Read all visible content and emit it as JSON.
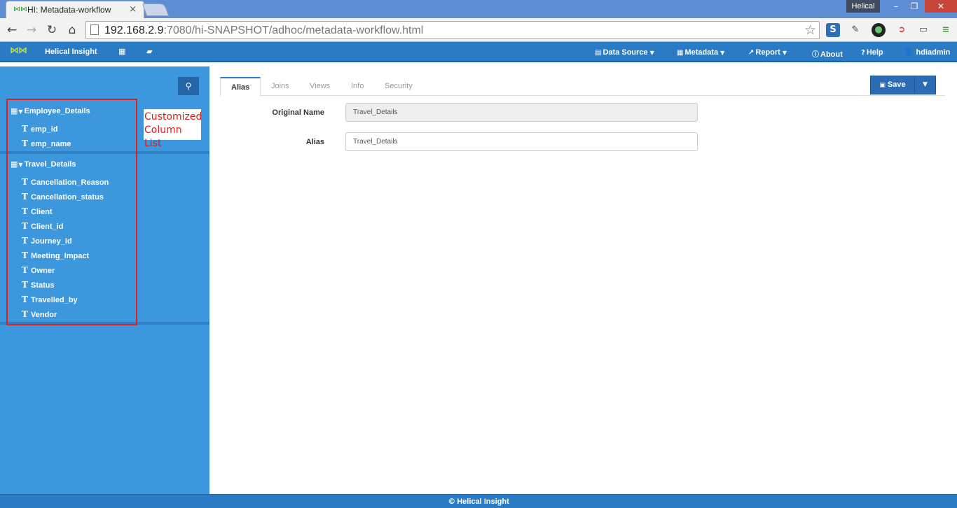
{
  "browser": {
    "tab_title": "HI: Metadata-workflow",
    "tab_favicon": "dna-logo-icon",
    "profile_name": "Helical",
    "url_host": "192.168.2.9",
    "url_rest": ":7080/hi-SNAPSHOT/adhoc/metadata-workflow.html",
    "extension_s_label": "S"
  },
  "navbar": {
    "brand": "Helical Insight",
    "items": [
      {
        "label": "Data Source",
        "icon": "database-icon",
        "has_caret": true
      },
      {
        "label": "Metadata",
        "icon": "table-icon",
        "has_caret": true
      },
      {
        "label": "Report",
        "icon": "line-chart-icon",
        "has_caret": true
      },
      {
        "label": "About",
        "icon": "info-circle-icon",
        "has_caret": false
      },
      {
        "label": "Help",
        "icon": "question-icon",
        "has_caret": false
      },
      {
        "label": "hdiadmin",
        "icon": "user-icon",
        "has_caret": false
      }
    ]
  },
  "sidebar": {
    "tables": [
      {
        "name": "Employee_Details",
        "columns": [
          "emp_id",
          "emp_name"
        ]
      },
      {
        "name": "Travel_Details",
        "columns": [
          "Cancellation_Reason",
          "Cancellation_status",
          "Client",
          "Client_id",
          "Journey_id",
          "Meeting_Impact",
          "Owner",
          "Status",
          "Travelled_by",
          "Vendor"
        ]
      }
    ],
    "annotation_line1": "Customized",
    "annotation_line2": "Column List"
  },
  "main": {
    "tabs": [
      {
        "label": "Alias",
        "active": true
      },
      {
        "label": "Joins",
        "active": false
      },
      {
        "label": "Views",
        "active": false
      },
      {
        "label": "Info",
        "active": false
      },
      {
        "label": "Security",
        "active": false
      }
    ],
    "save_label": "Save",
    "original_name_label": "Original Name",
    "original_name_value": "Travel_Details",
    "alias_label": "Alias",
    "alias_value": "Travel_Details"
  },
  "footer": {
    "text": "Helical Insight"
  },
  "colors": {
    "navbar": "#2b7bc4",
    "sidebar": "#3c97dc",
    "annotation": "#e02020",
    "save_button": "#2b6cb2"
  }
}
